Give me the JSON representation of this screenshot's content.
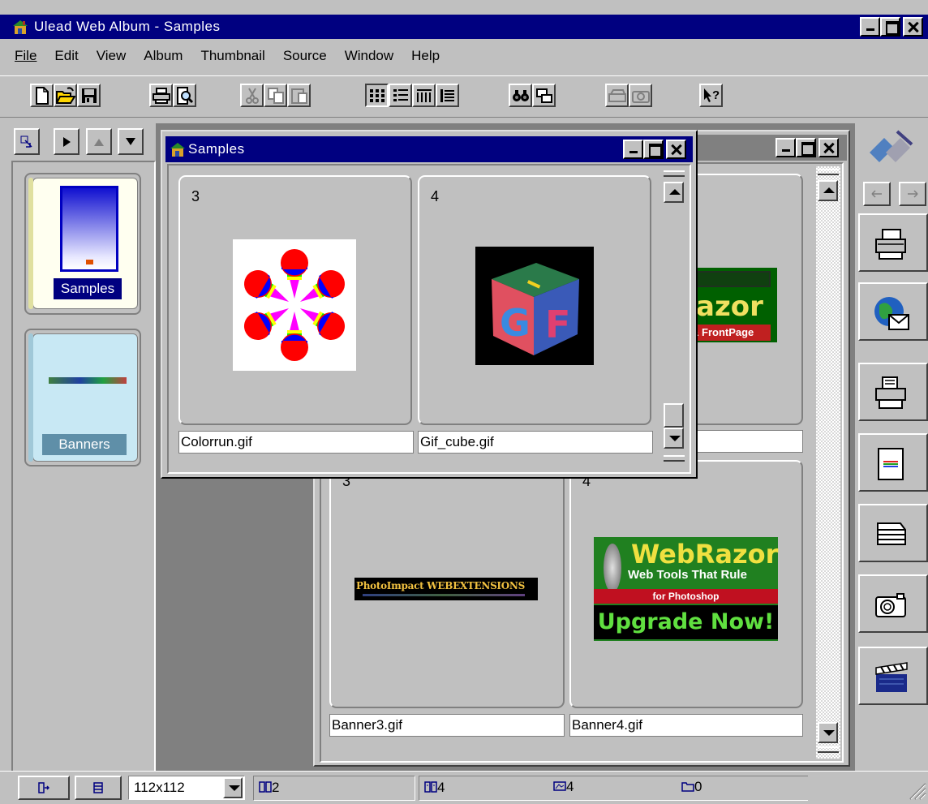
{
  "window": {
    "title": "Ulead Web Album - Samples"
  },
  "menu": [
    "File",
    "Edit",
    "View",
    "Album",
    "Thumbnail",
    "Source",
    "Window",
    "Help"
  ],
  "toolbar_icons": [
    "new-icon",
    "open-icon",
    "save-icon",
    "print-icon",
    "print-preview-icon",
    "cut-icon",
    "copy-icon",
    "paste-icon",
    "large-icons-view-icon",
    "details-view-icon",
    "small-icons-view-icon",
    "list-view-icon",
    "find-icon",
    "duplicate-icon",
    "scanner-icon",
    "camera-icon",
    "help-icon"
  ],
  "album_nav_icons": [
    "select-icon",
    "play-icon",
    "up-icon",
    "down-icon"
  ],
  "albums": [
    {
      "label": "Samples",
      "selected": true
    },
    {
      "label": "Banners",
      "selected": false
    }
  ],
  "samples_window": {
    "title": "Samples",
    "thumbnails": [
      {
        "number": "3",
        "filename": "Colorrun.gif"
      },
      {
        "number": "4",
        "filename": "Gif_cube.gif"
      }
    ]
  },
  "banners_window": {
    "thumbnails": [
      {
        "number": "3",
        "filename": "Banner3.gif",
        "banner_text": "PhotoImpact WEBEXTENSIONS"
      },
      {
        "number": "4",
        "filename": "Banner4.gif",
        "banner_line1": "WebRazor",
        "banner_line2": "Web Tools That Rule",
        "banner_line3": "for Photoshop",
        "banner_line4": "Upgrade Now!"
      }
    ],
    "partial_banner": {
      "line1": "azor",
      "line2": "& FrontPage"
    },
    "partial_filename": ""
  },
  "cube_letters": {
    "top": "I",
    "left": "G",
    "right": "F"
  },
  "right_panel_icons": [
    "tools-icon",
    "back-icon",
    "forward-icon",
    "printer-icon",
    "email-globe-icon",
    "fax-printer-icon",
    "web-page-icon",
    "scanner-output-icon",
    "camera-output-icon",
    "slideshow-clapper-icon"
  ],
  "statusbar": {
    "thumb_size": "112x112",
    "albums_count": "2",
    "pages_count": "4",
    "images_count": "4",
    "folders_count": "0"
  }
}
